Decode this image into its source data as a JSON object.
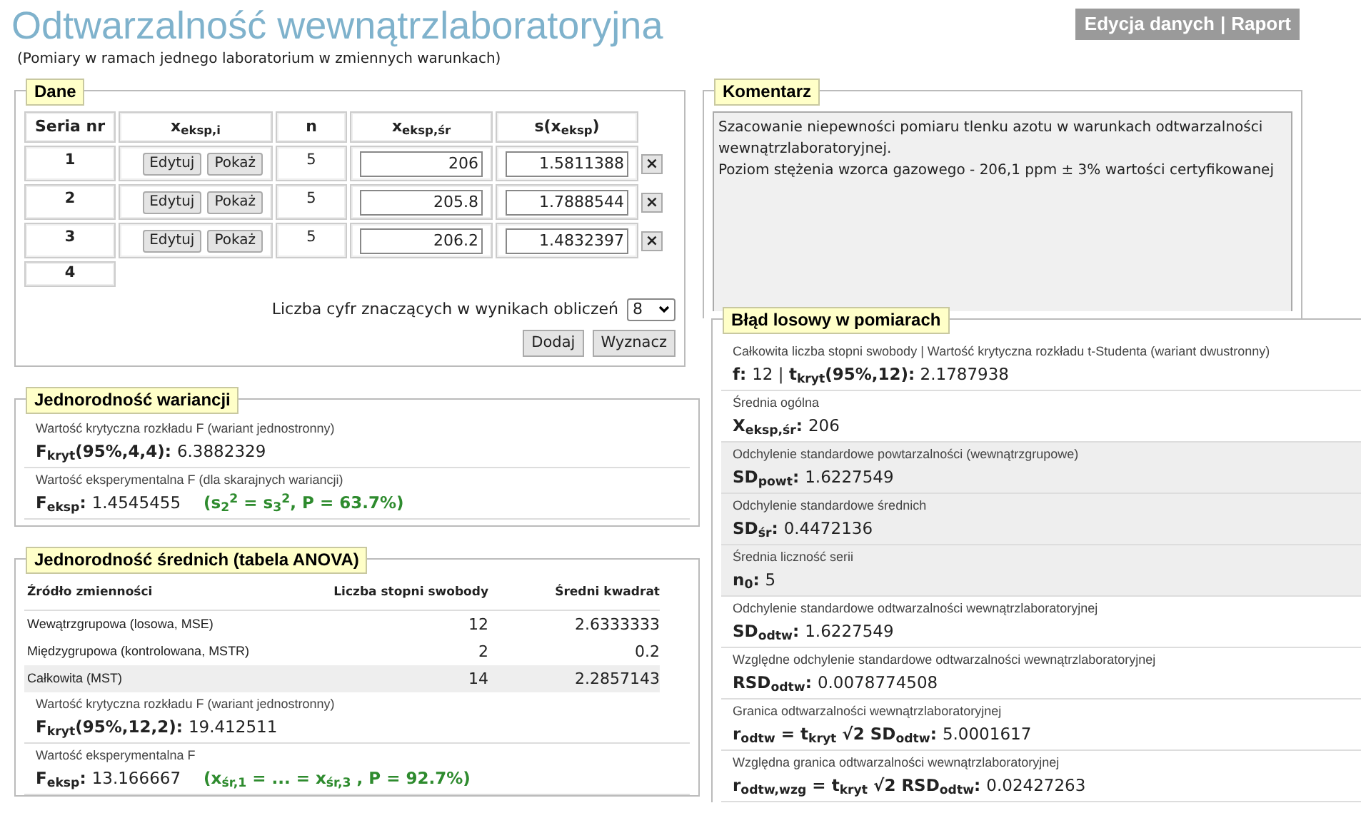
{
  "header": {
    "title": "Odtwarzalność wewnątrzlaboratoryjna",
    "subtitle": "(Pomiary w ramach jednego laboratorium w zmiennych warunkach)",
    "nav_links": [
      "Edycja danych",
      "Raport"
    ],
    "nav_separator": "|"
  },
  "dane": {
    "legend": "Dane",
    "columns": [
      "Seria nr",
      "x$_{eksp,i}$",
      "n",
      "x$_{eksp,śr}$",
      "s(x$_{eksp}$)"
    ],
    "rows": [
      {
        "series": "1",
        "buttons": [
          "Edytuj",
          "Pokaż"
        ],
        "n": "5",
        "mean": "206",
        "sd": "1.5811388",
        "delete": "×"
      },
      {
        "series": "2",
        "buttons": [
          "Edytuj",
          "Pokaż"
        ],
        "n": "5",
        "mean": "205.8",
        "sd": "1.7888544",
        "delete": "×"
      },
      {
        "series": "3",
        "buttons": [
          "Edytuj",
          "Pokaż"
        ],
        "n": "5",
        "mean": "206.2",
        "sd": "1.4832397",
        "delete": "×"
      }
    ],
    "new_row": "4",
    "digits_label": "Liczba cyfr znaczących w wynikach obliczeń",
    "digits_value": "8",
    "actions": [
      "Dodaj",
      "Wyznacz"
    ]
  },
  "komentarz": {
    "legend": "Komentarz",
    "text": "Szacowanie niepewności pomiaru tlenku azotu w warunkach odtwarzalności wewnątrzlaboratoryjnej.\nPoziom stężenia wzorca gazowego - 206,1 ppm ± 3% wartości certyfikowanej"
  },
  "wariancje": {
    "legend": "Jednorodność wariancji",
    "results": [
      {
        "label": "Wartość krytyczna rozkładu F (wariant jednostronny)",
        "formula": "F$_{kryt}$(95%,4,4):",
        "value": "6.3882329"
      },
      {
        "label": "Wartość eksperymentalna F (dla skarajnych wariancji)",
        "formula": "F$_{eksp}$:",
        "value": "1.4545455",
        "note": "(s$_{2}$$^{2}$ = s$_{3}$$^{2}$, P = 63.7%)"
      }
    ]
  },
  "anova": {
    "legend": "Jednorodność średnich (tabela ANOVA)",
    "columns": [
      "Źródło zmienności",
      "Liczba stopni swobody",
      "Średni kwadrat"
    ],
    "rows": [
      {
        "source": "Wewątrzgrupowa (losowa, MSE)",
        "df": "12",
        "ms": "2.6333333",
        "highlighted": false
      },
      {
        "source": "Międzygrupowa (kontrolowana, MSTR)",
        "df": "2",
        "ms": "0.2",
        "highlighted": false
      },
      {
        "source": "Całkowita (MST)",
        "df": "14",
        "ms": "2.2857143",
        "highlighted": true
      }
    ],
    "results": [
      {
        "label": "Wartość krytyczna rozkładu F (wariant jednostronny)",
        "formula": "F$_{kryt}$(95%,12,2):",
        "value": "19.412511"
      },
      {
        "label": "Wartość eksperymentalna F",
        "formula": "F$_{eksp}$:",
        "value": "13.166667",
        "note": "(x$_{śr,1}$ = ... = x$_{śr,3}$ , P = 92.7%)"
      }
    ]
  },
  "blad": {
    "legend": "Błąd losowy w pomiarach",
    "results": [
      {
        "label": "Całkowita liczba stopni swobody | Wartość krytyczna rozkładu t-Studenta (wariant dwustronny)",
        "formula": "f:",
        "value": "12 | **t$_{kryt}$(95%,12):** 2.1787938",
        "highlighted": false
      },
      {
        "label": "Średnia ogólna",
        "formula": "X$_{eksp,śr}$:",
        "value": "206",
        "highlighted": false
      },
      {
        "label": "Odchylenie standardowe powtarzalności (wewnątrzgrupowe)",
        "formula": "SD$_{powt}$:",
        "value": "1.6227549",
        "highlighted": true
      },
      {
        "label": "Odchylenie standardowe średnich",
        "formula": "SD$_{śr}$:",
        "value": "0.4472136",
        "highlighted": true
      },
      {
        "label": "Średnia liczność serii",
        "formula": "n$_{0}$:",
        "value": "5",
        "highlighted": true
      },
      {
        "label": "Odchylenie standardowe odtwarzalności wewnątrzlaboratoryjnej",
        "formula": "SD$_{odtw}$:",
        "value": "1.6227549",
        "highlighted": false
      },
      {
        "label": "Względne odchylenie standardowe odtwarzalności wewnątrzlaboratoryjnej",
        "formula": "RSD$_{odtw}$:",
        "value": "0.0078774508",
        "highlighted": false
      },
      {
        "label": "Granica odtwarzalności wewnątrzlaboratoryjnej",
        "formula": "r$_{odtw}$ = t$_{kryt}$ √2 SD$_{odtw}$:",
        "value": "5.0001617",
        "highlighted": false
      },
      {
        "label": "Względna granica odtwarzalności wewnątrzlaboratoryjnej",
        "formula": "r$_{odtw,wzg}$ = t$_{kryt}$ √2 RSD$_{odtw}$:",
        "value": "0.02427263",
        "highlighted": false
      }
    ]
  }
}
